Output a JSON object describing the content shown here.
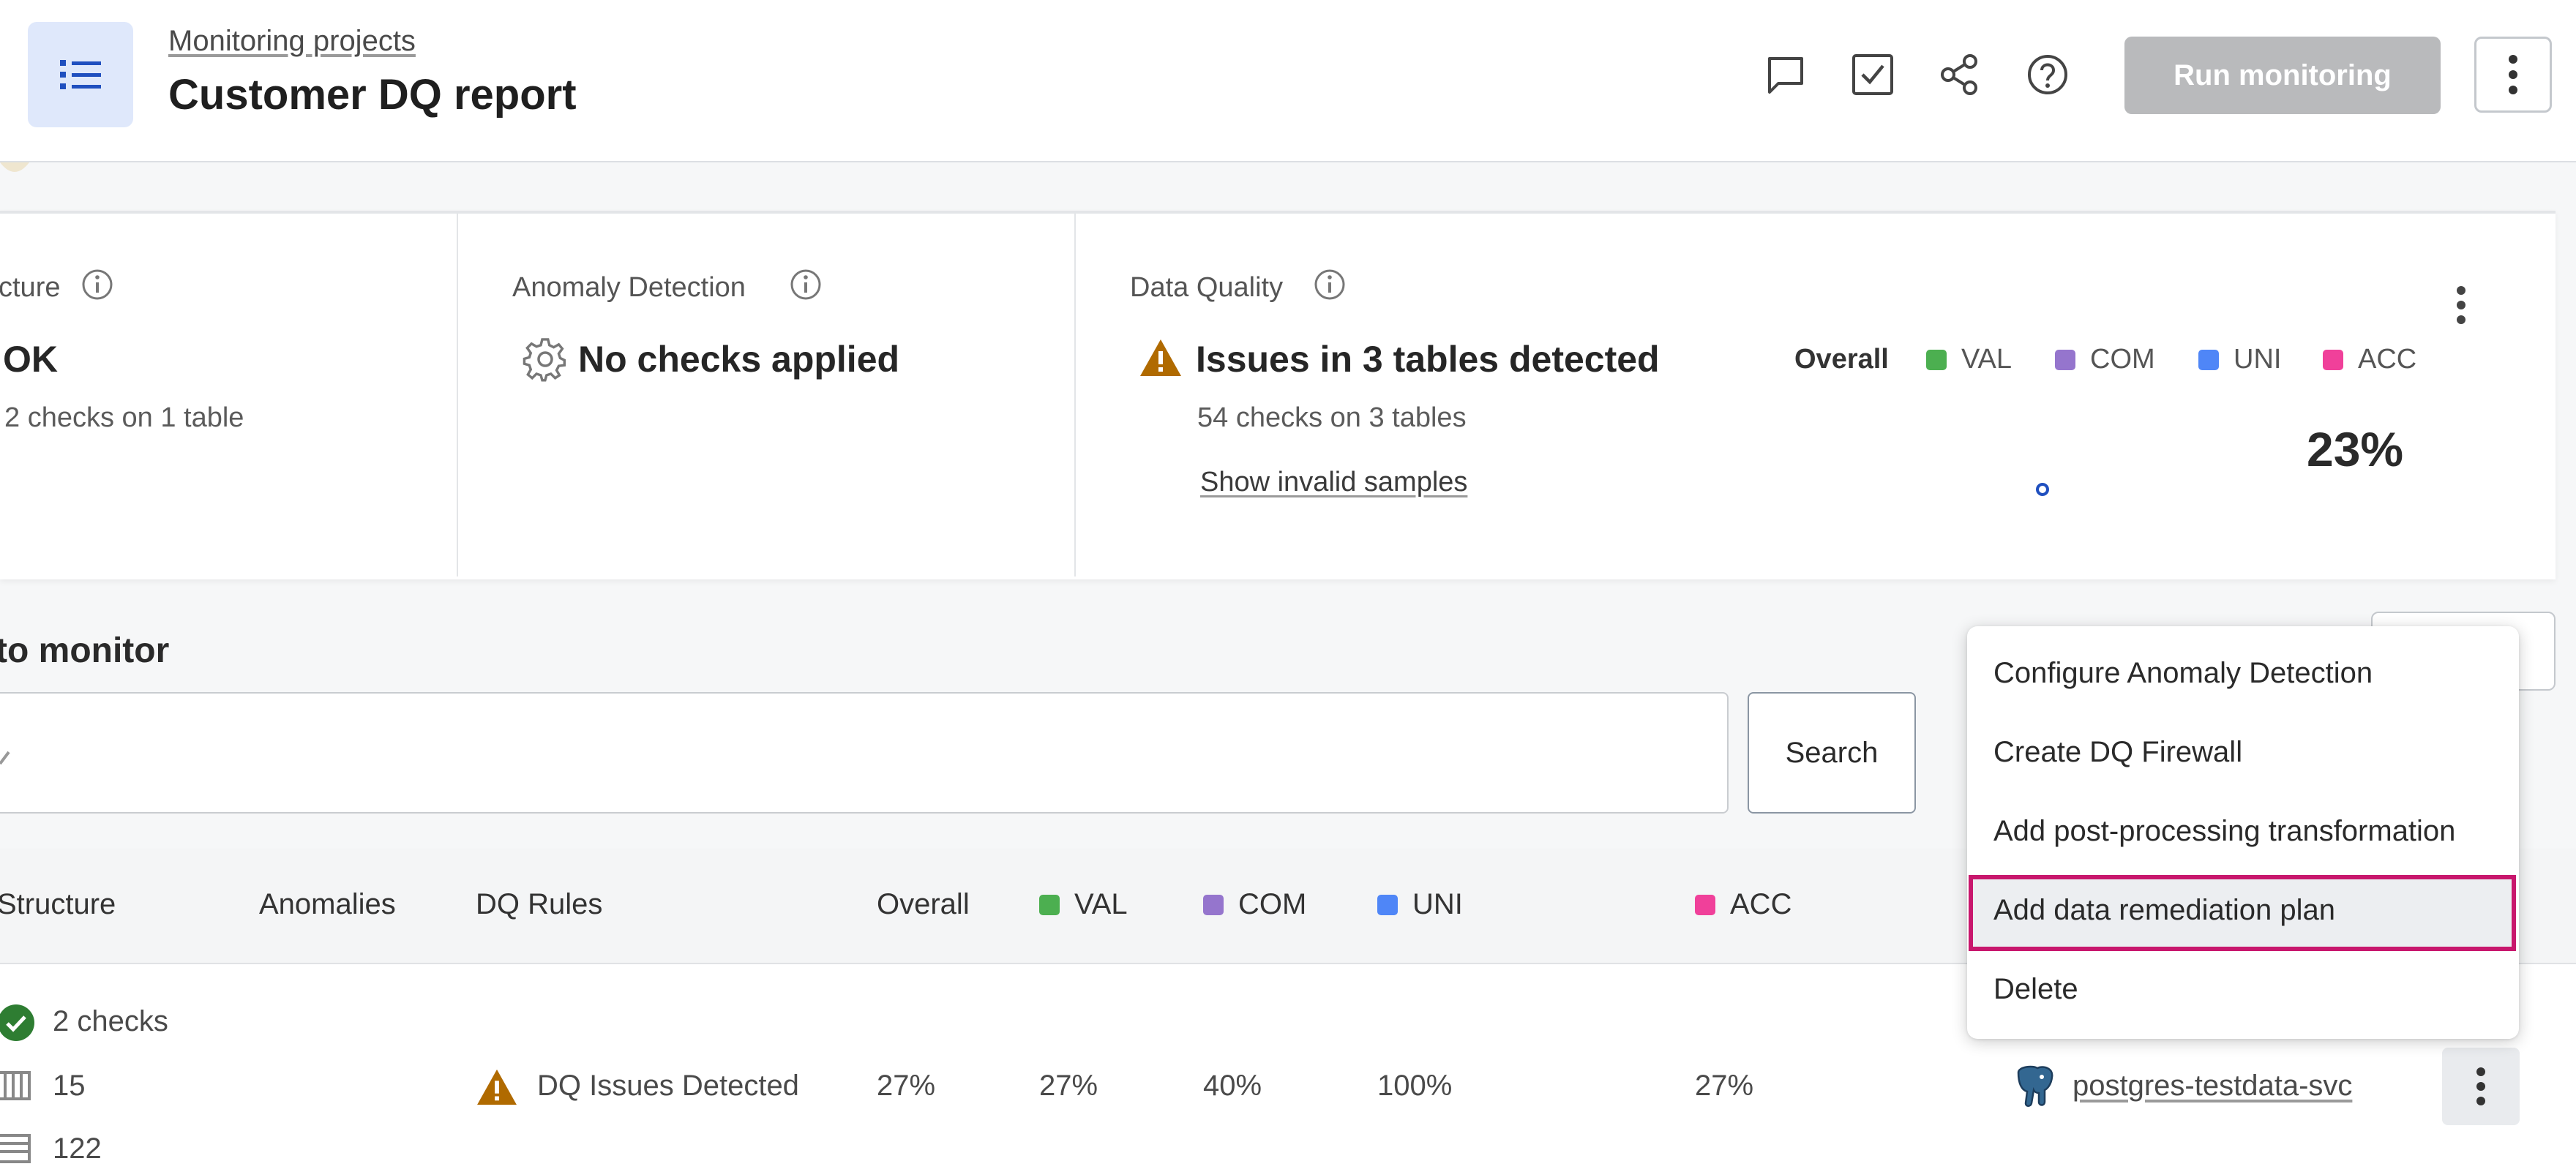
{
  "header": {
    "breadcrumb": "Monitoring projects",
    "title": "Customer DQ report",
    "run_label": "Run monitoring",
    "icons": [
      "list-icon",
      "comment-icon",
      "tasks-checkbox-icon",
      "share-icon",
      "help-icon",
      "more-vertical-icon"
    ]
  },
  "summary": {
    "structure": {
      "label": "cture",
      "status": "OK",
      "detail": "2 checks on 1 table"
    },
    "anomaly": {
      "label": "Anomaly Detection",
      "status": "No checks applied"
    },
    "quality": {
      "label": "Data Quality",
      "status": "Issues in 3 tables detected",
      "detail": "54 checks on 3 tables",
      "link": "Show invalid samples",
      "legend": [
        {
          "label": "Overall",
          "color": ""
        },
        {
          "label": "VAL",
          "color": "#4caf50"
        },
        {
          "label": "COM",
          "color": "#9575cd"
        },
        {
          "label": "UNI",
          "color": "#4f86f7"
        },
        {
          "label": "ACC",
          "color": "#f0409a"
        }
      ],
      "score": "23%"
    }
  },
  "section": {
    "title": "to monitor",
    "search_label": "Search"
  },
  "table": {
    "headers": [
      "Structure",
      "Anomalies",
      "DQ Rules",
      "Overall",
      "VAL",
      "COM",
      "UNI",
      "ACC"
    ],
    "row": {
      "structure_checks": "2 checks",
      "columns": "15",
      "rows": "122",
      "dq_status": "DQ Issues Detected",
      "overall": "27%",
      "val": "27%",
      "com": "40%",
      "uni": "100%",
      "acc": "27%",
      "connection": "postgres-testdata-svc"
    }
  },
  "menu": {
    "items": [
      "Configure Anomaly Detection",
      "Create DQ Firewall",
      "Add post-processing transformation",
      "Add data remediation plan",
      "Delete"
    ],
    "highlighted_index": 3
  },
  "colors": {
    "accent_blue": "#1f4fbf",
    "warning": "#b06a00",
    "ok_green": "#2e7d32",
    "highlight_border": "#c8176d"
  }
}
